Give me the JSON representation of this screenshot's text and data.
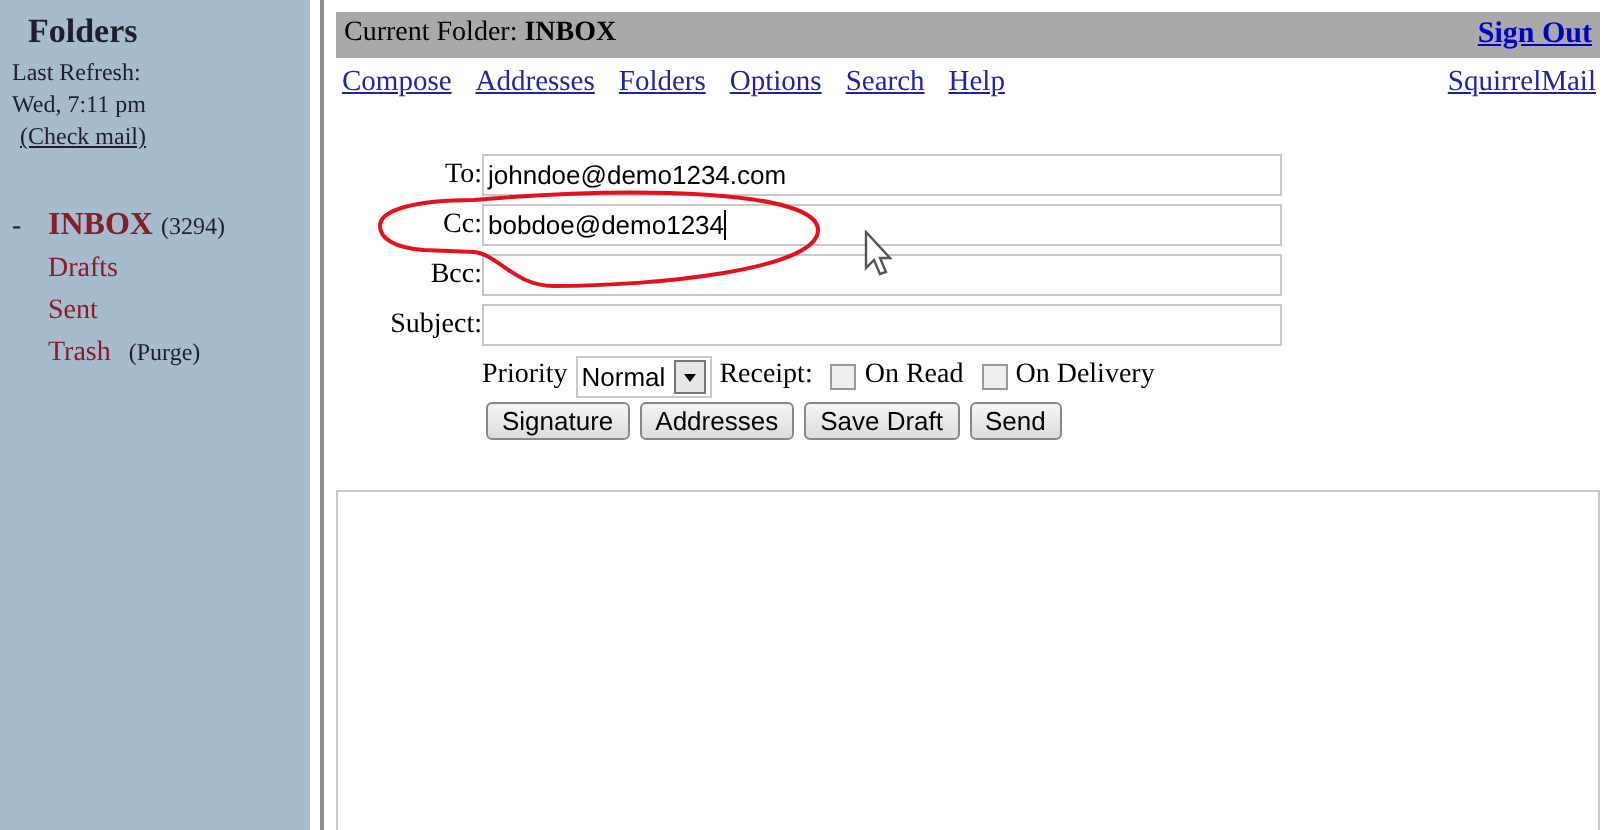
{
  "sidebar": {
    "title": "Folders",
    "refresh_label": "Last Refresh:",
    "refresh_time": "Wed, 7:11 pm",
    "check_mail": "(Check mail)",
    "folders": [
      {
        "marker": "-",
        "name": "INBOX",
        "count": "(3294)",
        "selected": true
      },
      {
        "name": "Drafts",
        "selected": false
      },
      {
        "name": "Sent",
        "selected": false
      },
      {
        "name": "Trash",
        "action": "(Purge)",
        "selected": false
      }
    ]
  },
  "header": {
    "folder_label": "Current Folder:",
    "folder_name": "INBOX",
    "sign_out": "Sign Out"
  },
  "nav": {
    "links": [
      "Compose",
      "Addresses",
      "Folders",
      "Options",
      "Search",
      "Help"
    ],
    "brand": "SquirrelMail"
  },
  "compose": {
    "fields": [
      {
        "label": "To:",
        "value": "johndoe@demo1234.com"
      },
      {
        "label": "Cc:",
        "value": "bobdoe@demo1234",
        "focused": true
      },
      {
        "label": "Bcc:"
      },
      {
        "label": "Subject:"
      }
    ],
    "priority_label": "Priority",
    "priority": "Normal",
    "receipt_label": "Receipt:",
    "receipts": [
      {
        "label": "On Read",
        "checked": false
      },
      {
        "label": "On Delivery",
        "checked": false
      }
    ],
    "buttons": [
      "Signature",
      "Addresses",
      "Save Draft",
      "Send"
    ]
  }
}
